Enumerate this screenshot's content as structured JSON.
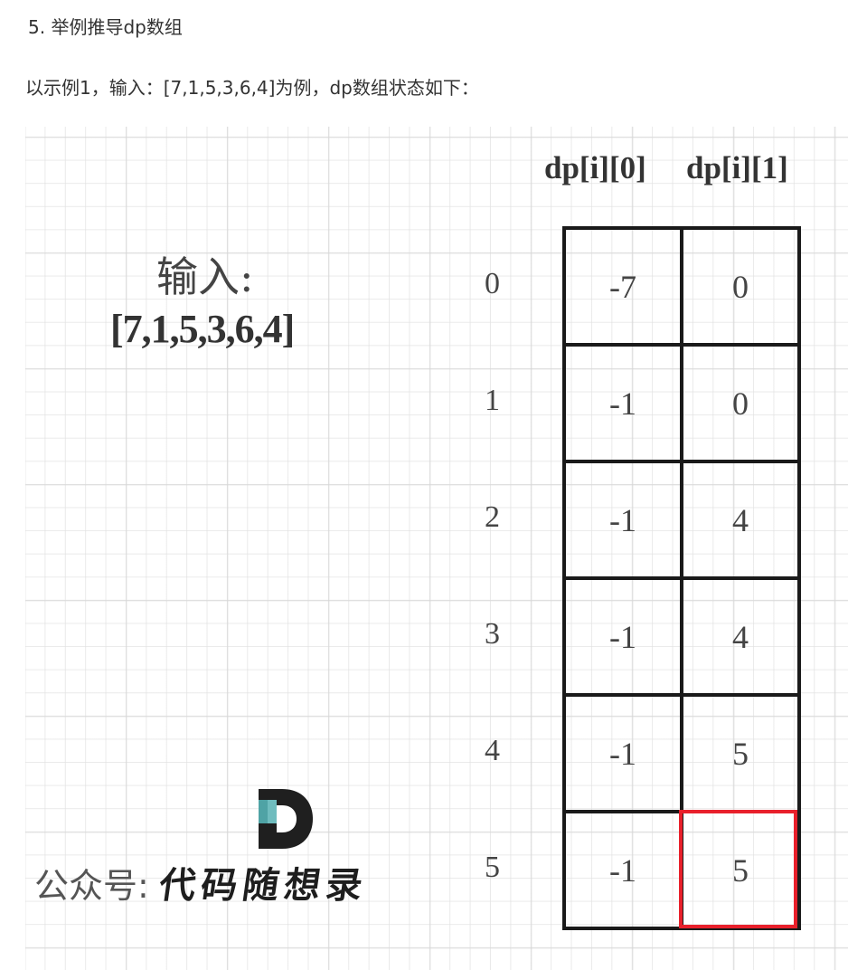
{
  "heading": "5. 举例推导dp数组",
  "intro": "以示例1，输入：[7,1,5,3,6,4]为例，dp数组状态如下：",
  "figure": {
    "input_label": "输入:",
    "input_array": "[7,1,5,3,6,4]",
    "col_headers": [
      "dp[i][0]",
      "dp[i][1]"
    ],
    "rows": [
      {
        "index": "0",
        "c0": "-7",
        "c1": "0"
      },
      {
        "index": "1",
        "c0": "-1",
        "c1": "0"
      },
      {
        "index": "2",
        "c0": "-1",
        "c1": "4"
      },
      {
        "index": "3",
        "c0": "-1",
        "c1": "4"
      },
      {
        "index": "4",
        "c0": "-1",
        "c1": "5"
      },
      {
        "index": "5",
        "c0": "-1",
        "c1": "5"
      }
    ],
    "highlighted_cell": {
      "row": "5",
      "col": "dp[i][1]",
      "color": "#e8202b"
    },
    "watermark": {
      "prefix": "公众号:",
      "name": "代码随想录",
      "logo_letter": "D",
      "logo_accent": "#4fa3a5"
    }
  }
}
